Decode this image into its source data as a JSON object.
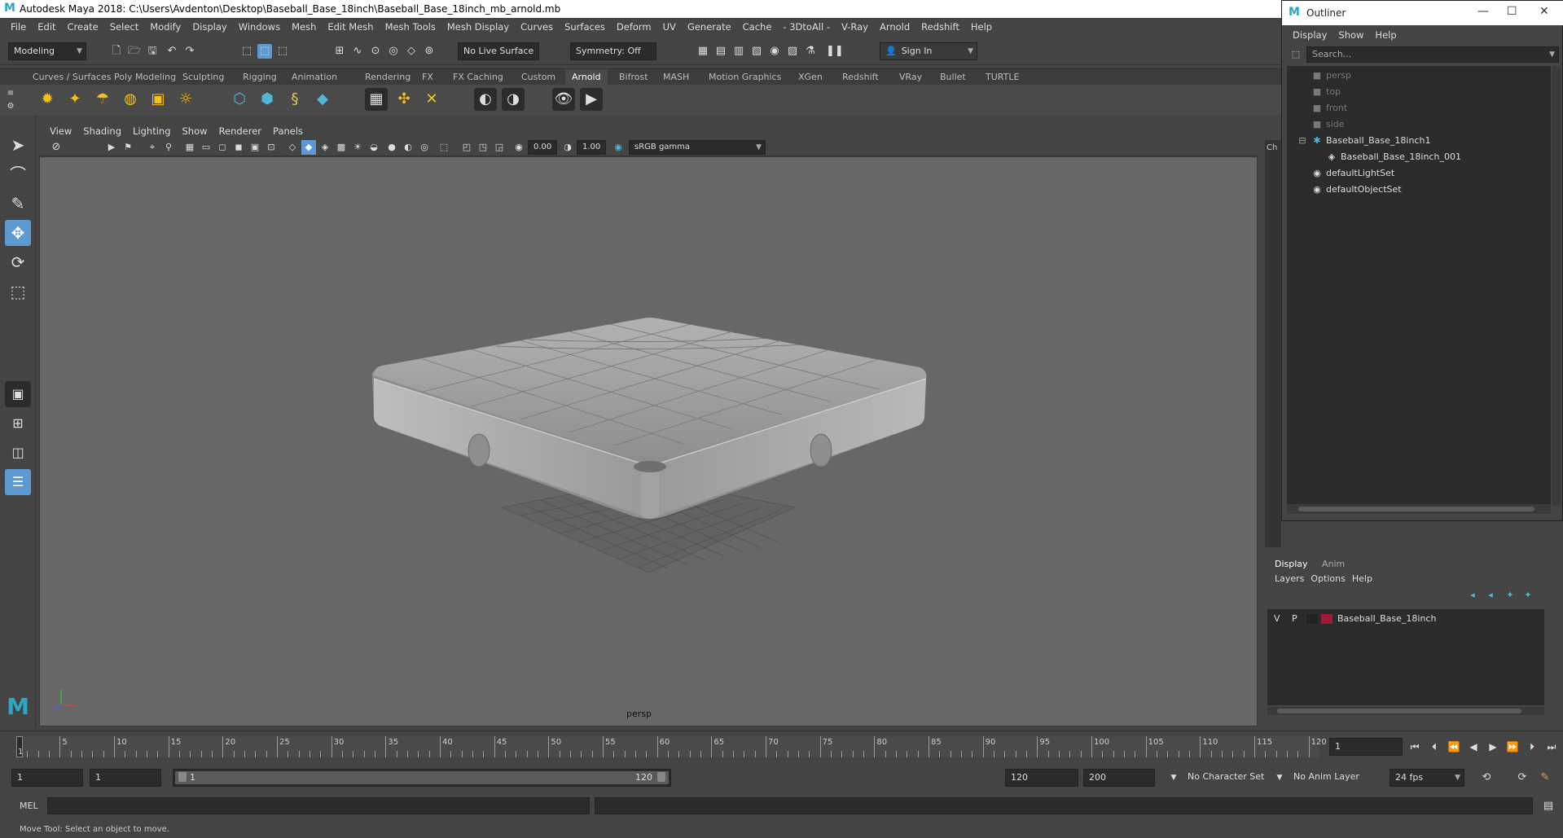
{
  "window": {
    "title": "Autodesk Maya 2018: C:\\Users\\Avdenton\\Desktop\\Baseball_Base_18inch\\Baseball_Base_18inch_mb_arnold.mb",
    "logo_glyph": "M"
  },
  "menubar": [
    "File",
    "Edit",
    "Create",
    "Select",
    "Modify",
    "Display",
    "Windows",
    "Mesh",
    "Edit Mesh",
    "Mesh Tools",
    "Mesh Display",
    "Curves",
    "Surfaces",
    "Deform",
    "UV",
    "Generate",
    "Cache",
    "- 3DtoAll -",
    "V-Ray",
    "Arnold",
    "Redshift",
    "Help"
  ],
  "statusline": {
    "mode": "Modeling",
    "live_surface": "No Live Surface",
    "symmetry": "Symmetry: Off",
    "sign_in": "Sign In"
  },
  "shelf_tabs": [
    "Curves / Surfaces",
    "Poly Modeling",
    "Sculpting",
    "Rigging",
    "Animation",
    "Rendering",
    "FX",
    "FX Caching",
    "Custom",
    "Arnold",
    "Bifrost",
    "MASH",
    "Motion Graphics",
    "XGen",
    "Redshift",
    "VRay",
    "Bullet",
    "TURTLE"
  ],
  "shelf_active_tab": "Arnold",
  "panel_menu": [
    "View",
    "Shading",
    "Lighting",
    "Show",
    "Renderer",
    "Panels"
  ],
  "panel_toolbar": {
    "exposure": "0.00",
    "gamma": "1.00",
    "color_space": "sRGB gamma"
  },
  "viewport": {
    "camera_label": "persp",
    "bg_color": "#676767"
  },
  "timeline": {
    "ticks": [
      "5",
      "10",
      "15",
      "20",
      "25",
      "30",
      "35",
      "40",
      "45",
      "50",
      "55",
      "60",
      "65",
      "70",
      "75",
      "80",
      "85",
      "90",
      "95",
      "100",
      "105",
      "110",
      "115",
      "120"
    ],
    "current_frame": "1",
    "current_frame_field": "1"
  },
  "range": {
    "start": "1",
    "playback_start": "1",
    "slider_start": "1",
    "slider_end": "120",
    "playback_end": "120",
    "end": "200",
    "character_set": "No Character Set",
    "anim_layer": "No Anim Layer",
    "fps": "24 fps"
  },
  "mel": {
    "label": "MEL"
  },
  "helpline": "Move Tool: Select an object to move.",
  "outliner": {
    "title": "Outliner",
    "menu": [
      "Display",
      "Show",
      "Help"
    ],
    "search_placeholder": "Search...",
    "items": [
      {
        "label": "persp",
        "dim": true
      },
      {
        "label": "top",
        "dim": true
      },
      {
        "label": "front",
        "dim": true
      },
      {
        "label": "side",
        "dim": true
      },
      {
        "label": "Baseball_Base_18inch1",
        "dim": false
      },
      {
        "label": "Baseball_Base_18inch_001",
        "dim": false
      },
      {
        "label": "defaultLightSet",
        "dim": false
      },
      {
        "label": "defaultObjectSet",
        "dim": false
      }
    ]
  },
  "channel_box_tab": "Ch",
  "layer_editor": {
    "tabs": [
      "Display",
      "Anim"
    ],
    "menu": [
      "Layers",
      "Options",
      "Help"
    ],
    "layer": {
      "v": "V",
      "p": "P",
      "name": "Baseball_Base_18inch",
      "color": "#9c1b35"
    }
  }
}
